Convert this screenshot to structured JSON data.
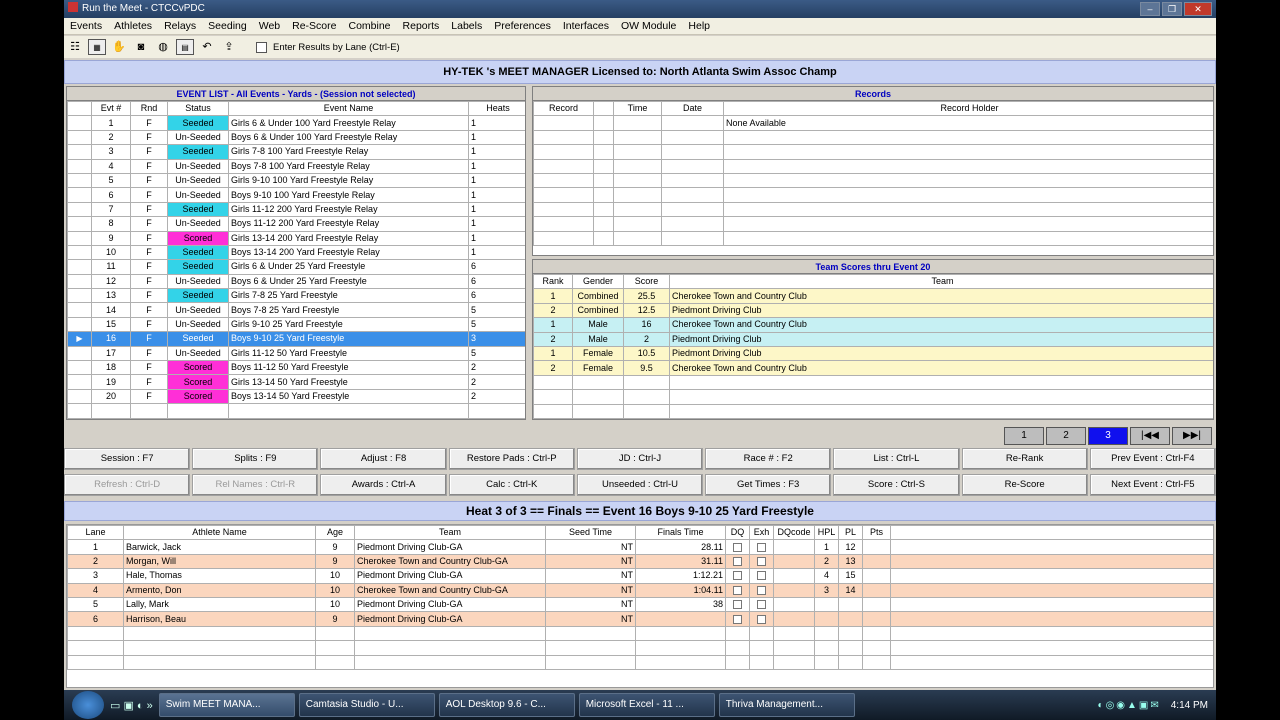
{
  "window": {
    "title": "Run the Meet - CTCCvPDC"
  },
  "menu": [
    "Events",
    "Athletes",
    "Relays",
    "Seeding",
    "Web",
    "Re-Score",
    "Combine",
    "Reports",
    "Labels",
    "Preferences",
    "Interfaces",
    "OW Module",
    "Help"
  ],
  "toolbar": {
    "enter_lane_label": "Enter Results by Lane (Ctrl-E)"
  },
  "license": "HY-TEK 's MEET MANAGER Licensed to:  North Atlanta Swim Assoc Champ",
  "event_list": {
    "title": "EVENT LIST - All Events - Yards - (Session not selected)",
    "headers": [
      "Evt #",
      "Rnd",
      "Status",
      "Event Name",
      "Heats"
    ],
    "rows": [
      [
        "1",
        "F",
        "Seeded",
        "Girls 6 & Under 100 Yard Freestyle Relay",
        "1"
      ],
      [
        "2",
        "F",
        "Un-Seeded",
        "Boys 6 & Under 100 Yard Freestyle Relay",
        "1"
      ],
      [
        "3",
        "F",
        "Seeded",
        "Girls 7-8 100 Yard Freestyle Relay",
        "1"
      ],
      [
        "4",
        "F",
        "Un-Seeded",
        "Boys 7-8 100 Yard Freestyle Relay",
        "1"
      ],
      [
        "5",
        "F",
        "Un-Seeded",
        "Girls 9-10 100 Yard Freestyle Relay",
        "1"
      ],
      [
        "6",
        "F",
        "Un-Seeded",
        "Boys 9-10 100 Yard Freestyle Relay",
        "1"
      ],
      [
        "7",
        "F",
        "Seeded",
        "Girls 11-12 200 Yard Freestyle Relay",
        "1"
      ],
      [
        "8",
        "F",
        "Un-Seeded",
        "Boys 11-12 200 Yard Freestyle Relay",
        "1"
      ],
      [
        "9",
        "F",
        "Scored",
        "Girls 13-14 200 Yard Freestyle Relay",
        "1"
      ],
      [
        "10",
        "F",
        "Seeded",
        "Boys 13-14 200 Yard Freestyle Relay",
        "1"
      ],
      [
        "11",
        "F",
        "Seeded",
        "Girls 6 & Under 25 Yard Freestyle",
        "6"
      ],
      [
        "12",
        "F",
        "Un-Seeded",
        "Boys 6 & Under 25 Yard Freestyle",
        "6"
      ],
      [
        "13",
        "F",
        "Seeded",
        "Girls 7-8 25 Yard Freestyle",
        "6"
      ],
      [
        "14",
        "F",
        "Un-Seeded",
        "Boys 7-8 25 Yard Freestyle",
        "5"
      ],
      [
        "15",
        "F",
        "Un-Seeded",
        "Girls 9-10 25 Yard Freestyle",
        "5"
      ],
      [
        "16",
        "F",
        "Seeded",
        "Boys 9-10 25 Yard Freestyle",
        "3"
      ],
      [
        "17",
        "F",
        "Un-Seeded",
        "Girls 11-12 50 Yard Freestyle",
        "5"
      ],
      [
        "18",
        "F",
        "Scored",
        "Boys 11-12 50 Yard Freestyle",
        "2"
      ],
      [
        "19",
        "F",
        "Scored",
        "Girls 13-14 50 Yard Freestyle",
        "2"
      ],
      [
        "20",
        "F",
        "Scored",
        "Boys 13-14 50 Yard Freestyle",
        "2"
      ]
    ],
    "selected_index": 15,
    "pointer": "▶"
  },
  "records": {
    "title": "Records",
    "headers": [
      "Record",
      "",
      "Time",
      "Date",
      "Record Holder"
    ],
    "first_row": [
      "",
      "",
      "",
      "",
      "None Available"
    ]
  },
  "team_scores": {
    "title": "Team Scores thru Event 20",
    "headers": [
      "Rank",
      "Gender",
      "Score",
      "Team"
    ],
    "rows": [
      [
        "1",
        "Combined",
        "25.5",
        "Cherokee Town and Country Club"
      ],
      [
        "2",
        "Combined",
        "12.5",
        "Piedmont Driving Club"
      ],
      [
        "1",
        "Male",
        "16",
        "Cherokee Town and Country Club"
      ],
      [
        "2",
        "Male",
        "2",
        "Piedmont Driving Club"
      ],
      [
        "1",
        "Female",
        "10.5",
        "Piedmont Driving Club"
      ],
      [
        "2",
        "Female",
        "9.5",
        "Cherokee Town and Country Club"
      ]
    ]
  },
  "heat_pager": {
    "buttons": [
      "1",
      "2",
      "3",
      "|◀◀",
      "▶▶|"
    ],
    "active": "3"
  },
  "buttons_row1": [
    "Session : F7",
    "Splits : F9",
    "Adjust : F8",
    "Restore Pads : Ctrl-P",
    "JD : Ctrl-J",
    "Race # : F2",
    "List : Ctrl-L",
    "Re-Rank",
    "Prev Event : Ctrl-F4"
  ],
  "buttons_row2": [
    "Refresh : Ctrl-D",
    "Rel Names : Ctrl-R",
    "Awards : Ctrl-A",
    "Calc : Ctrl-K",
    "Unseeded : Ctrl-U",
    "Get Times : F3",
    "Score : Ctrl-S",
    "Re-Score",
    "Next Event : Ctrl-F5"
  ],
  "buttons_row2_dim": [
    true,
    true,
    false,
    false,
    false,
    false,
    false,
    false,
    false
  ],
  "heat_title": "Heat  3  of  3  ==  Finals  ==  Event 16  Boys 9-10 25 Yard Freestyle",
  "results": {
    "headers": [
      "Lane",
      "Athlete Name",
      "Age",
      "Team",
      "Seed Time",
      "Finals Time",
      "DQ",
      "Exh",
      "DQcode",
      "HPL",
      "PL",
      "Pts"
    ],
    "rows": [
      [
        "1",
        "Barwick, Jack",
        "9",
        "Piedmont Driving Club-GA",
        "NT",
        "28.11",
        "",
        "",
        "",
        "1",
        "12",
        ""
      ],
      [
        "2",
        "Morgan, Will",
        "9",
        "Cherokee Town and Country Club-GA",
        "NT",
        "31.11",
        "",
        "",
        "",
        "2",
        "13",
        ""
      ],
      [
        "3",
        "Hale, Thomas",
        "10",
        "Piedmont Driving Club-GA",
        "NT",
        "1:12.21",
        "",
        "",
        "",
        "4",
        "15",
        ""
      ],
      [
        "4",
        "Armento, Don",
        "10",
        "Cherokee Town and Country Club-GA",
        "NT",
        "1:04.11",
        "",
        "",
        "",
        "3",
        "14",
        ""
      ],
      [
        "5",
        "Lally, Mark",
        "10",
        "Piedmont Driving Club-GA",
        "NT",
        "38",
        "",
        "",
        "",
        "",
        "",
        ""
      ],
      [
        "6",
        "Harrison, Beau",
        "9",
        "Piedmont Driving Club-GA",
        "NT",
        "",
        "",
        "",
        "",
        "",
        "",
        ""
      ]
    ]
  },
  "taskbar": {
    "tasks": [
      "Swim MEET MANA...",
      "Camtasia Studio - U...",
      "AOL Desktop 9.6 - C...",
      "Microsoft Excel - 11 ...",
      "Thriva Management..."
    ],
    "active_task": 0,
    "clock": "4:14 PM"
  },
  "colors": {
    "seeded": "#33d3e8",
    "scored": "#ff2fd7",
    "selected": "#3a8fe8",
    "license_bar": "#c9d3f4"
  }
}
